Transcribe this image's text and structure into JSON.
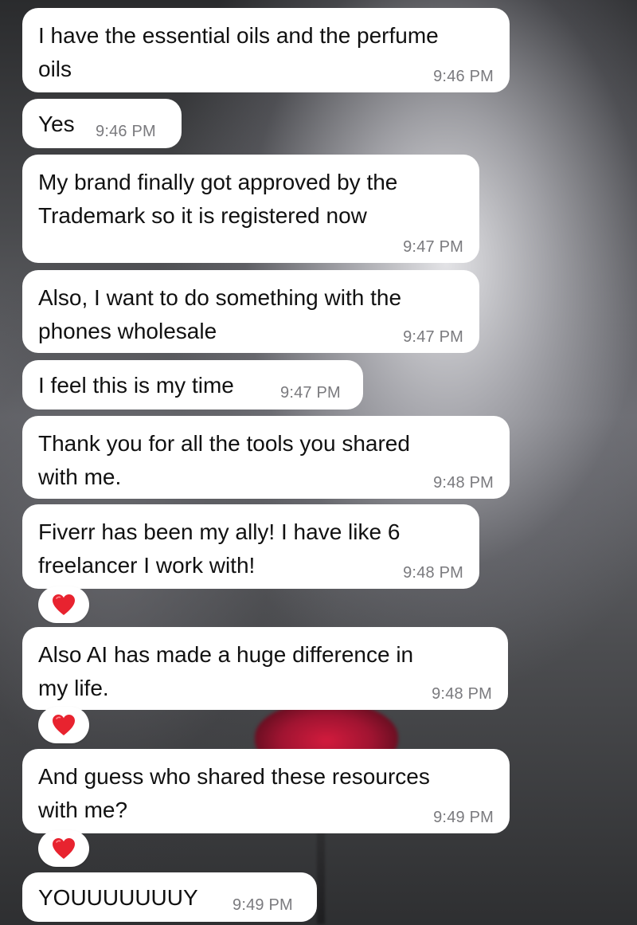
{
  "messages": [
    {
      "text": "I have the essential oils and the perfume\noils",
      "time": "9:46 PM"
    },
    {
      "text": "Yes",
      "time": "9:46 PM"
    },
    {
      "text": "My brand finally got approved by the\nTrademark so it is registered now",
      "time": "9:47 PM"
    },
    {
      "text": "Also, I want to do something with the\nphones wholesale",
      "time": "9:47 PM"
    },
    {
      "text": "I feel this is my time",
      "time": "9:47 PM"
    },
    {
      "text": "Thank you for all the tools you shared\nwith me.",
      "time": "9:48 PM"
    },
    {
      "text": "Fiverr has been my ally! I have like 6\nfreelancer I work with!",
      "time": "9:48 PM",
      "reaction": "heart-icon"
    },
    {
      "text": "Also AI has made a huge difference in\nmy life.",
      "time": "9:48 PM",
      "reaction": "heart-icon"
    },
    {
      "text": "And guess who shared these resources\nwith me?",
      "time": "9:49 PM",
      "reaction": "heart-icon"
    },
    {
      "text": "YOUUUUUUUY",
      "time": "9:49 PM"
    }
  ],
  "colors": {
    "bubble": "#ffffff",
    "text": "#111111",
    "timestamp": "#7a7a7e",
    "heart": "#e8232f"
  }
}
